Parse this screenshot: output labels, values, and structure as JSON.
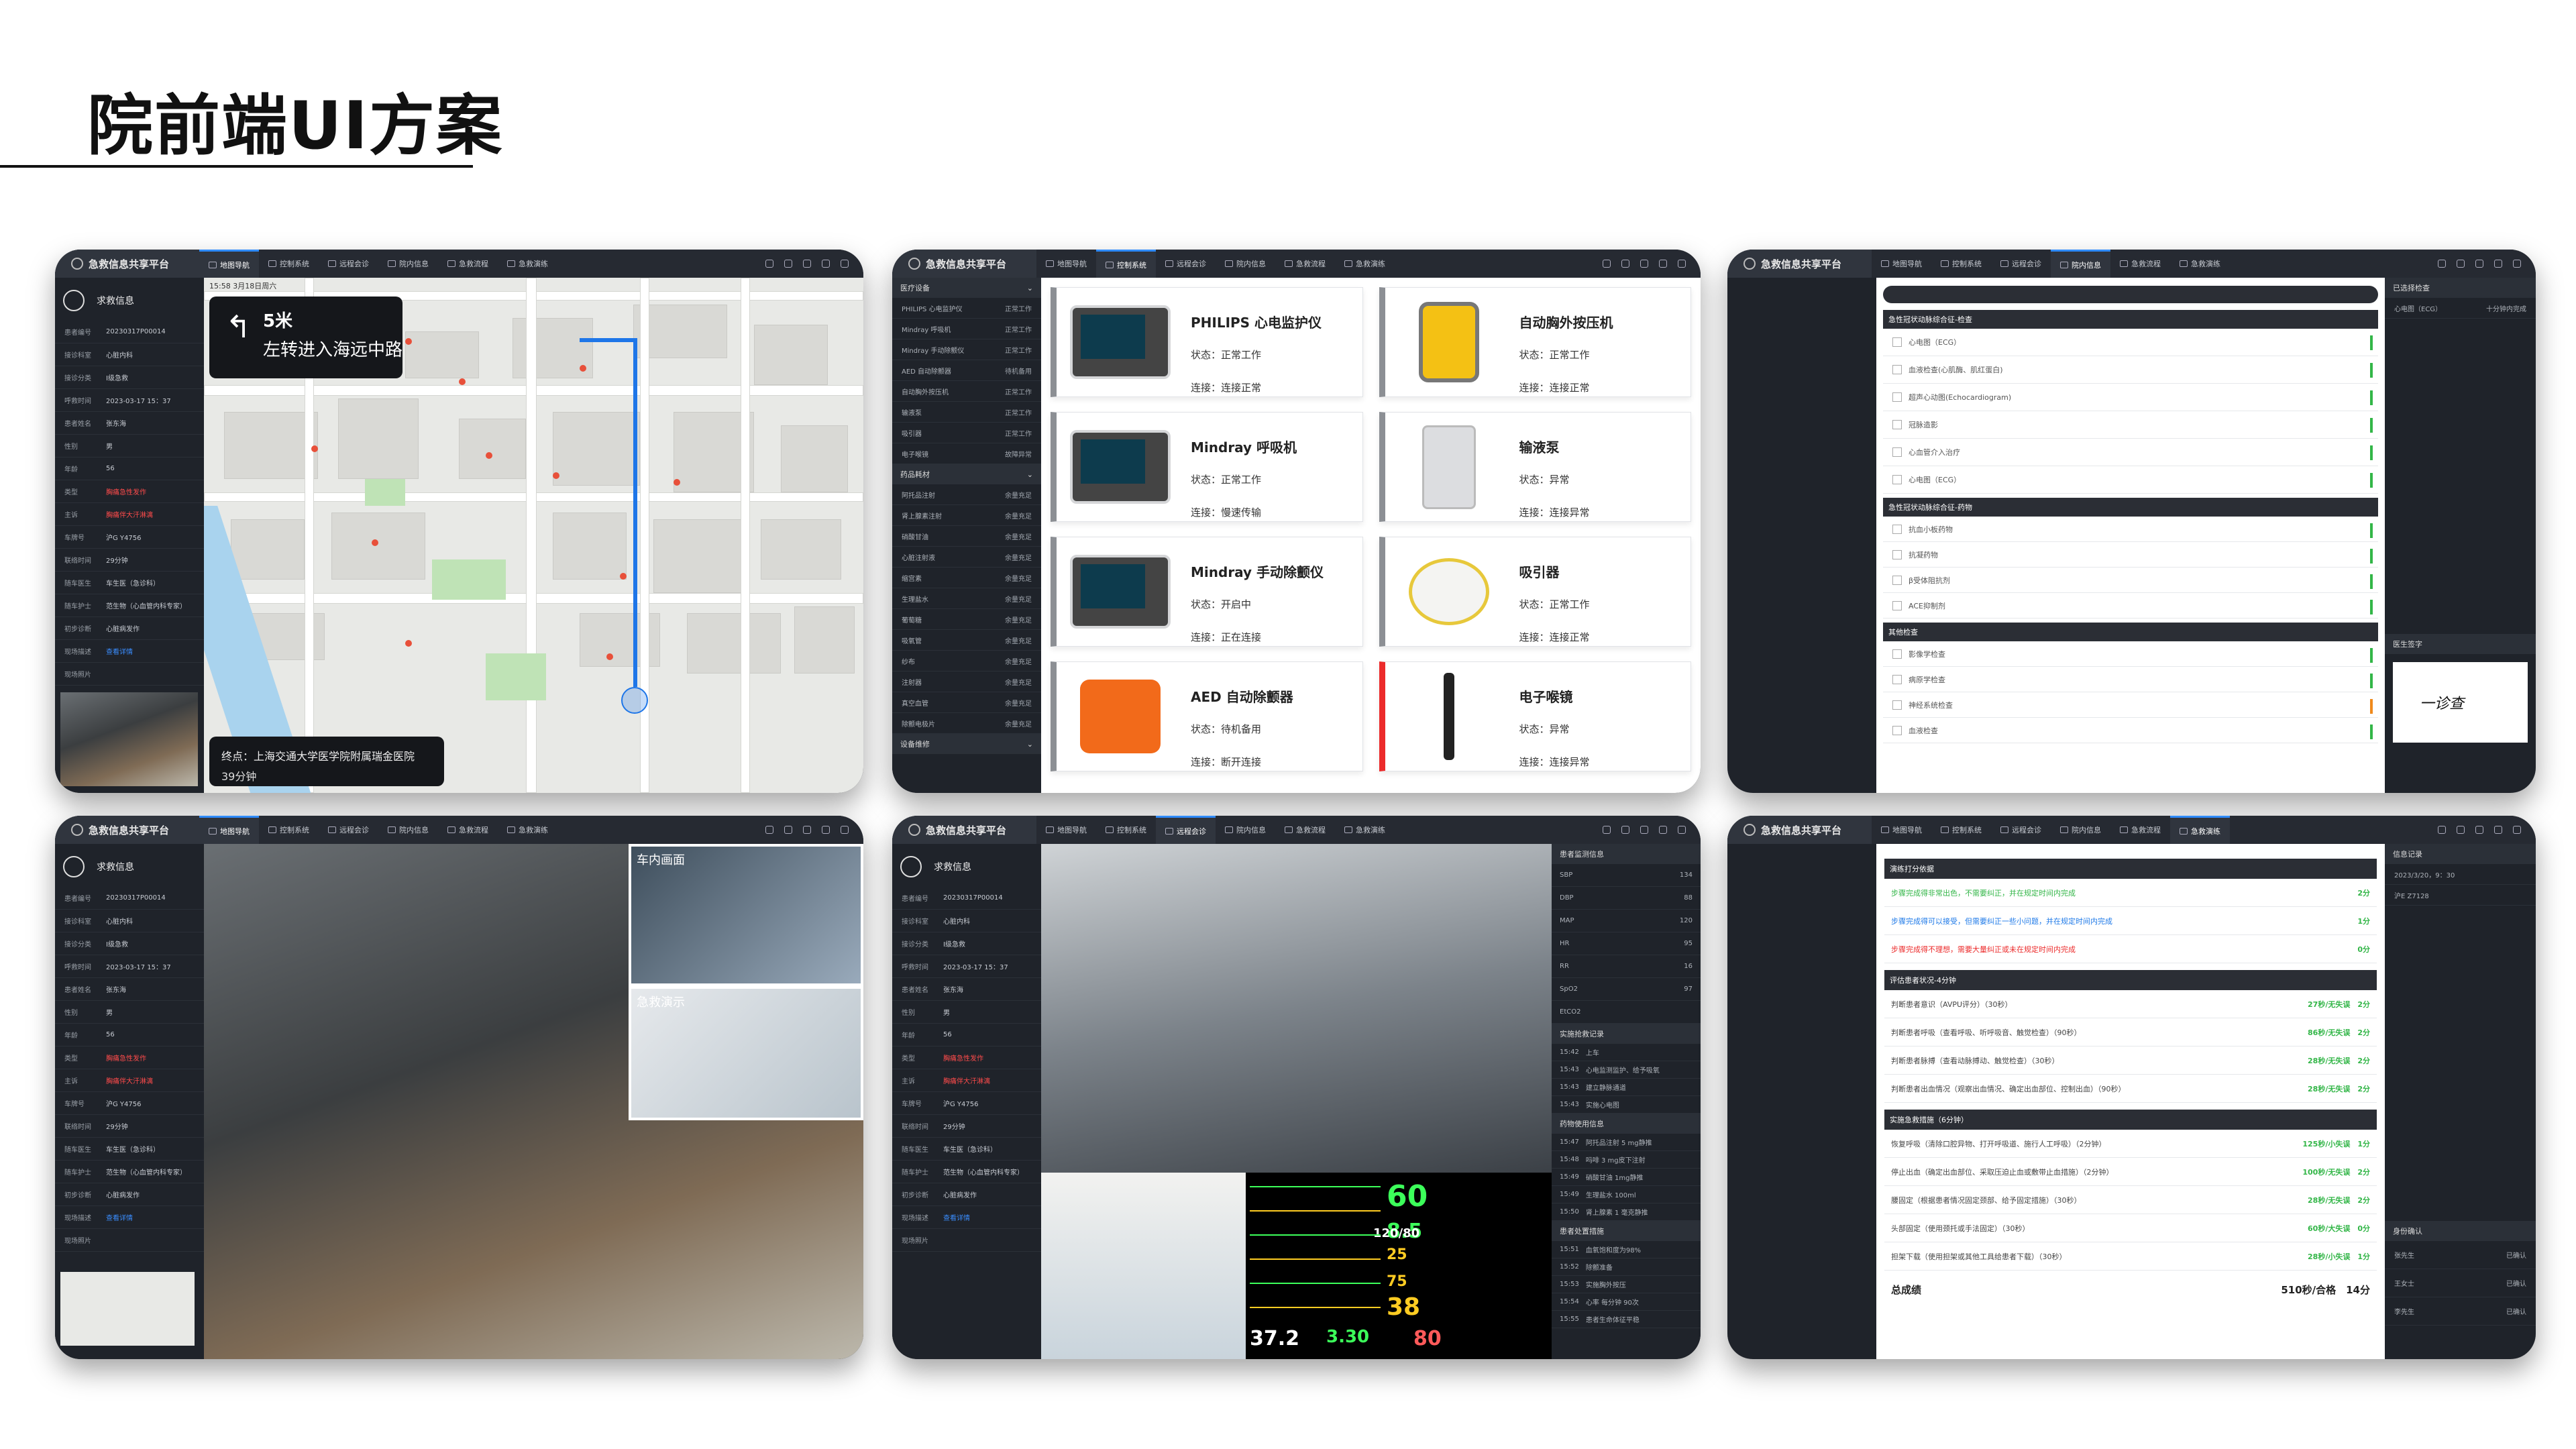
{
  "page_title": "院前端UI方案",
  "app": {
    "brand": "急救信息共享平台",
    "nav": [
      "地图导航",
      "控制系统",
      "远程会诊",
      "院内信息",
      "急救流程",
      "急救演练"
    ]
  },
  "patient": {
    "header": "求救信息",
    "fields": [
      {
        "k": "患者编号",
        "v": "20230317P00014"
      },
      {
        "k": "接诊科室",
        "v": "心脏内科"
      },
      {
        "k": "接诊分类",
        "v": "I级急救"
      },
      {
        "k": "呼救时间",
        "v": "2023-03-17 15：37"
      },
      {
        "k": "患者姓名",
        "v": "张东海"
      },
      {
        "k": "性别",
        "v": "男"
      },
      {
        "k": "年龄",
        "v": "56"
      },
      {
        "k": "类型",
        "v": "胸痛急性发作"
      },
      {
        "k": "主诉",
        "v": "胸痛伴大汗淋漓"
      },
      {
        "k": "车牌号",
        "v": "沪G Y4756"
      },
      {
        "k": "联络时间",
        "v": "29分钟"
      },
      {
        "k": "随车医生",
        "v": "车生医（急诊科）"
      },
      {
        "k": "随车护士",
        "v": "范生物（心血管内科专家）"
      },
      {
        "k": "初步诊断",
        "v": "心脏病发作"
      },
      {
        "k": "现场描述",
        "v": "查看详情"
      },
      {
        "k": "现场照片",
        "v": ""
      }
    ]
  },
  "map": {
    "time": "15:58 3月18日周六",
    "distance": "5米",
    "instruction": "左转进入海远中路",
    "destination": "终点：上海交通大学医学院附属瑞金医院",
    "eta": "39分钟"
  },
  "device_sidebar": {
    "sections": [
      "医疗设备",
      "药品耗材",
      "设备维修"
    ],
    "devices": [
      {
        "n": "PHILIPS 心电监护仪",
        "s": "正常工作"
      },
      {
        "n": "Mindray 呼吸机",
        "s": "正常工作"
      },
      {
        "n": "Mindray 手动除颤仪",
        "s": "正常工作"
      },
      {
        "n": "AED 自动除颤器",
        "s": "待机备用"
      },
      {
        "n": "自动胸外按压机",
        "s": "正常工作"
      },
      {
        "n": "输液泵",
        "s": "正常工作"
      },
      {
        "n": "吸引器",
        "s": "正常工作"
      },
      {
        "n": "电子喉镜",
        "s": "故障异常"
      }
    ],
    "drugs": [
      {
        "n": "阿托品注射",
        "s": "余量充足"
      },
      {
        "n": "肾上腺素注射",
        "s": "余量充足"
      },
      {
        "n": "硝酸甘油",
        "s": "余量充足"
      },
      {
        "n": "心脏注射液",
        "s": "余量充足"
      },
      {
        "n": "缩宫素",
        "s": "余量充足"
      },
      {
        "n": "生理盐水",
        "s": "余量充足"
      },
      {
        "n": "葡萄糖",
        "s": "余量充足"
      },
      {
        "n": "吸氧管",
        "s": "余量充足"
      },
      {
        "n": "纱布",
        "s": "余量充足"
      },
      {
        "n": "注射器",
        "s": "余量充足"
      },
      {
        "n": "真空血管",
        "s": "余量充足"
      },
      {
        "n": "除颤电极片",
        "s": "余量充足"
      }
    ]
  },
  "devices": [
    {
      "name": "PHILIPS 心电监护仪",
      "status": "状态：正常工作",
      "link": "连接：连接正常",
      "kind": "mon",
      "err": false
    },
    {
      "name": "自动胸外按压机",
      "status": "状态：正常工作",
      "link": "连接：连接正常",
      "kind": "yel",
      "err": false
    },
    {
      "name": "Mindray 呼吸机",
      "status": "状态：正常工作",
      "link": "连接：慢速传输",
      "kind": "mon",
      "err": false
    },
    {
      "name": "输液泵",
      "status": "状态：异常",
      "link": "连接：连接异常",
      "kind": "pump",
      "err": false
    },
    {
      "name": "Mindray 手动除颤仪",
      "status": "状态：开启中",
      "link": "连接：正在连接",
      "kind": "mon",
      "err": false
    },
    {
      "name": "吸引器",
      "status": "状态：正常工作",
      "link": "连接：连接正常",
      "kind": "suction",
      "err": false
    },
    {
      "name": "AED 自动除颤器",
      "status": "状态：待机备用",
      "link": "连接：断开连接",
      "kind": "aed",
      "err": false
    },
    {
      "name": "电子喉镜",
      "status": "状态：异常",
      "link": "连接：连接异常",
      "kind": "laryn",
      "err": true
    }
  ],
  "checklist": {
    "sections": [
      {
        "title": "急性冠状动脉综合征-检查",
        "items": [
          "心电图（ECG）",
          "血液检查(心肌酶、肌红蛋白)",
          "超声心动图(Echocardiogram)",
          "冠脉造影",
          "心血管介入治疗",
          "心电图（ECG）"
        ]
      },
      {
        "title": "急性冠状动脉综合征-药物",
        "items": [
          "抗血小板药物",
          "抗凝药物",
          "β受体阻抗剂",
          "ACE抑制剂"
        ]
      },
      {
        "title": "其他检查",
        "items": [
          "影像学检查",
          "病原学检查",
          "神经系统检查",
          "血液检查"
        ]
      }
    ],
    "right_head": "已选择检查",
    "right_item": "心电图（ECG）",
    "right_meta": "十分钟内完成",
    "sign_head": "医生签字",
    "signature": "一诊查"
  },
  "video": {
    "pip1": "车内画面",
    "pip2": "急救演示",
    "ekg_nums": [
      "60",
      "8.5",
      "25",
      "75",
      "38",
      "37.2",
      "3.30",
      "80",
      "120/80"
    ]
  },
  "vitals": {
    "head1": "患者监测信息",
    "rows": [
      {
        "k": "SBP",
        "v": "134"
      },
      {
        "k": "DBP",
        "v": "88"
      },
      {
        "k": "MAP",
        "v": "120"
      },
      {
        "k": "HR",
        "v": "95"
      },
      {
        "k": "RR",
        "v": "16"
      },
      {
        "k": "SpO2",
        "v": "97"
      },
      {
        "k": "EtCO2",
        "v": ""
      }
    ],
    "head2": "实施抢救记录",
    "records": [
      {
        "t": "15:42",
        "d": "上车"
      },
      {
        "t": "15:43",
        "d": "心电监测监护、给予吸氧"
      },
      {
        "t": "15:43",
        "d": "建立静脉通道"
      },
      {
        "t": "15:43",
        "d": "实施心电图"
      }
    ],
    "head3": "药物使用信息",
    "drugs": [
      {
        "t": "15:47",
        "d": "阿托品注射 5 mg静推"
      },
      {
        "t": "15:48",
        "d": "吗啡 3 mg皮下注射"
      },
      {
        "t": "15:49",
        "d": "硝酸甘油 1mg静推"
      },
      {
        "t": "15:49",
        "d": "生理盐水 100ml"
      },
      {
        "t": "15:50",
        "d": "肾上腺素 1 毫克静推"
      }
    ],
    "head4": "患者处置措施",
    "actions": [
      {
        "t": "15:51",
        "d": "血氧饱和度为98%"
      },
      {
        "t": "15:52",
        "d": "除颤准备"
      },
      {
        "t": "15:53",
        "d": "实施胸外按压"
      },
      {
        "t": "15:54",
        "d": "心率 每分钟 90次"
      },
      {
        "t": "15:55",
        "d": "患者生命体征平稳"
      }
    ]
  },
  "score": {
    "sections": [
      {
        "title": "演练打分依据",
        "rows": [
          {
            "d": "步骤完成得非常出色，不需要纠正，并在规定时间内完成",
            "p": "2分",
            "c": "g"
          },
          {
            "d": "步骤完成得可以接受，但需要纠正一些小问题，并在规定时间内完成",
            "p": "1分",
            "c": "b"
          },
          {
            "d": "步骤完成得不理想，需要大量纠正或未在规定时间内完成",
            "p": "0分",
            "c": "r"
          }
        ]
      },
      {
        "title": "评估患者状况-4分钟",
        "rows": [
          {
            "d": "判断患者意识（AVPU评分）（30秒）",
            "p": "27秒/无失误　2分",
            "c": ""
          },
          {
            "d": "判断患者呼吸（查看呼吸、听呼吸音、触觉检查）（90秒）",
            "p": "86秒/无失误　2分",
            "c": ""
          },
          {
            "d": "判断患者脉搏（查看动脉搏动、触觉检查）（30秒）",
            "p": "28秒/无失误　2分",
            "c": ""
          },
          {
            "d": "判断患者出血情况（观察出血情况、确定出血部位、控制出血）（90秒）",
            "p": "28秒/无失误　2分",
            "c": ""
          }
        ]
      },
      {
        "title": "实施急救措施（6分钟）",
        "rows": [
          {
            "d": "恢复呼吸（清除口腔异物、打开呼吸道、施行人工呼吸）（2分钟）",
            "p": "125秒/小失误　1分",
            "c": ""
          },
          {
            "d": "停止出血（确定出血部位、采取压迫止血或敷带止血措施）（2分钟）",
            "p": "100秒/无失误　2分",
            "c": ""
          },
          {
            "d": "腰固定（根据患者情况固定颈部、给予固定措施）（30秒）",
            "p": "28秒/无失误　2分",
            "c": ""
          },
          {
            "d": "头部固定（使用颈托或手法固定）（30秒）",
            "p": "60秒/大失误　0分",
            "c": ""
          },
          {
            "d": "担架下载（使用担架或其他工具给患者下载）（30秒）",
            "p": "28秒/小失误　1分",
            "c": ""
          }
        ]
      }
    ],
    "total_label": "总成绩",
    "total_value": "510秒/合格　14分",
    "right_head": "信息记录",
    "right_time": "2023/3/20，9：30",
    "right_loc": "沪E Z7128",
    "sign_head": "身份确认",
    "signers": [
      {
        "n": "张先生",
        "s": "已确认"
      },
      {
        "n": "王女士",
        "s": "已确认"
      },
      {
        "n": "李先生",
        "s": "已确认"
      }
    ]
  }
}
